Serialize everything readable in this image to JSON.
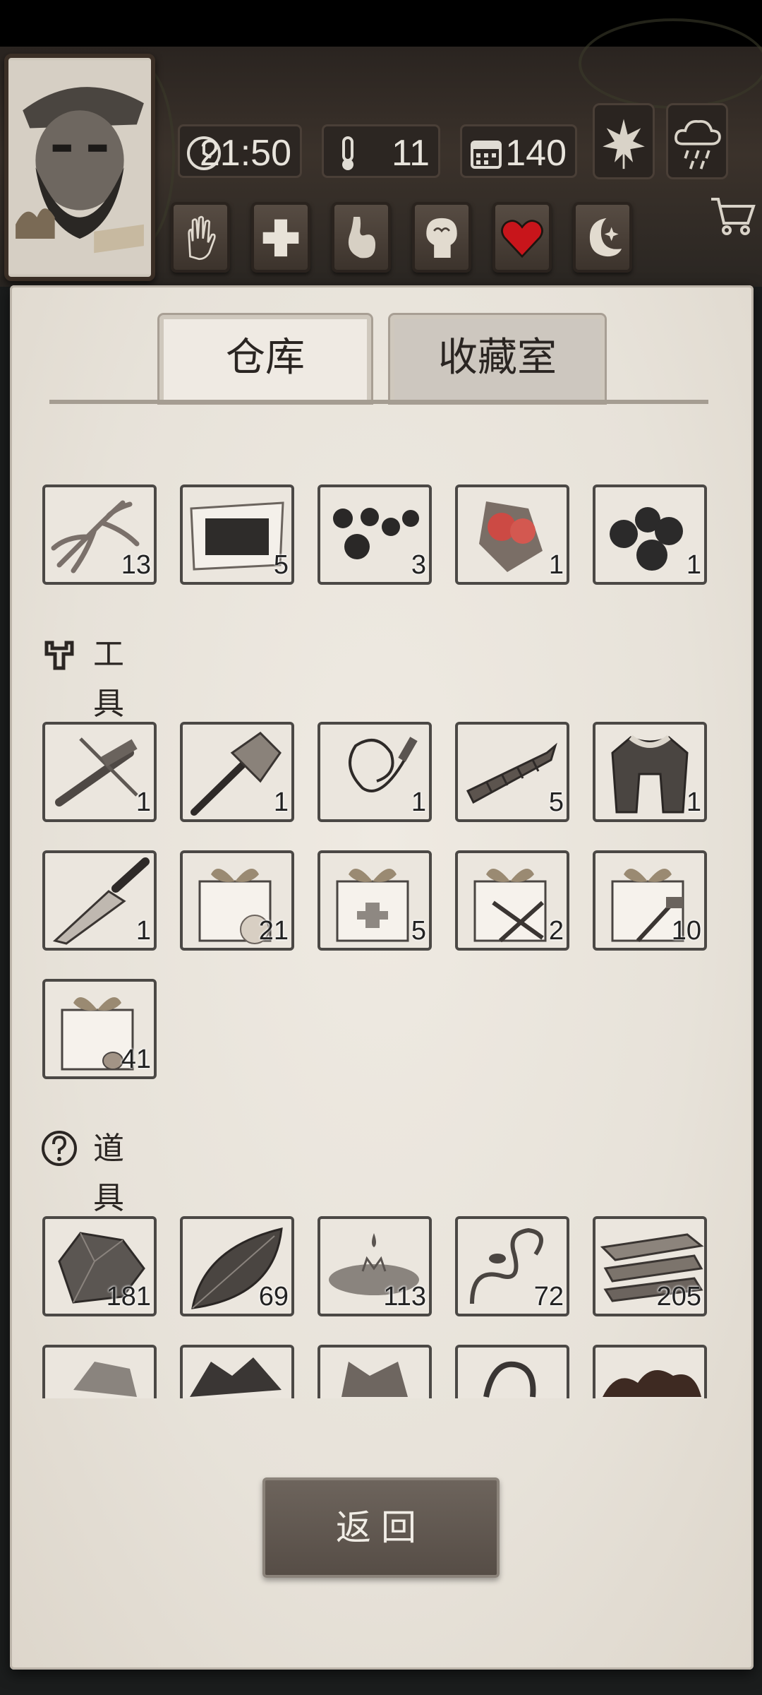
{
  "header": {
    "time": "21:50",
    "temperature": "11",
    "day": "140",
    "weather_icons": [
      "leaf-icon",
      "rain-cloud-icon"
    ],
    "status_icons": [
      "hand-icon",
      "medical-cross-icon",
      "stomach-icon",
      "head-brain-icon",
      "heart-icon",
      "moon-icon"
    ],
    "shop_icon": "cart-icon"
  },
  "tabs": [
    {
      "label": "仓库",
      "active": true
    },
    {
      "label": "收藏室",
      "active": false
    }
  ],
  "sections": {
    "tools_title": "工具",
    "props_title": "道具"
  },
  "items": {
    "top_row": [
      {
        "name": "ginseng",
        "count": "13"
      },
      {
        "name": "charcoal-paper",
        "count": "5"
      },
      {
        "name": "black-pills",
        "count": "3"
      },
      {
        "name": "red-berries",
        "count": "1"
      },
      {
        "name": "black-berries",
        "count": "1"
      }
    ],
    "tools": [
      {
        "name": "crossbow",
        "count": "1"
      },
      {
        "name": "axe",
        "count": "1"
      },
      {
        "name": "whip",
        "count": "1"
      },
      {
        "name": "drill-bit",
        "count": "5"
      },
      {
        "name": "fur-coat",
        "count": "1"
      },
      {
        "name": "hunting-knife",
        "count": "1"
      },
      {
        "name": "gift-box-food",
        "count": "21"
      },
      {
        "name": "gift-box-medical",
        "count": "5"
      },
      {
        "name": "gift-box-weapons",
        "count": "2"
      },
      {
        "name": "gift-box-tools",
        "count": "10"
      },
      {
        "name": "gift-box-wood",
        "count": "41"
      }
    ],
    "props": [
      {
        "name": "stone",
        "count": "181"
      },
      {
        "name": "leaf",
        "count": "69"
      },
      {
        "name": "water-puddle",
        "count": "113"
      },
      {
        "name": "vine",
        "count": "72"
      },
      {
        "name": "wood-planks",
        "count": "205"
      },
      {
        "name": "rock-partial",
        "count": ""
      },
      {
        "name": "ore-partial",
        "count": ""
      },
      {
        "name": "hide-partial",
        "count": ""
      },
      {
        "name": "rope-partial",
        "count": ""
      },
      {
        "name": "mud-partial",
        "count": ""
      }
    ]
  },
  "back_button": "返回"
}
